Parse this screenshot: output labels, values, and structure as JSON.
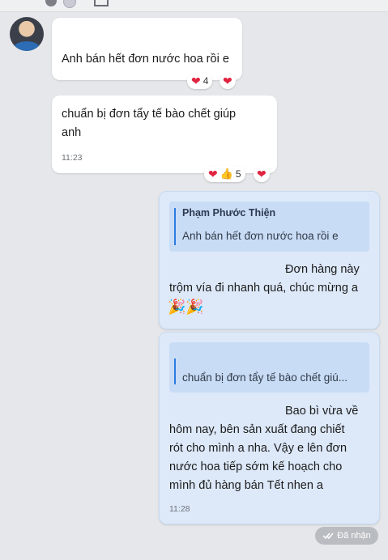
{
  "messages": [
    {
      "text": "Anh bán hết đơn nước hoa rồi e",
      "reactions": {
        "count": "4"
      }
    },
    {
      "text_lines": [
        "chuẩn bị đơn tẩy tế bào chết giúp",
        "anh"
      ],
      "time": "11:23",
      "reactions": {
        "count": "5"
      }
    },
    {
      "quote_name": "Phạm Phước Thiện",
      "quote_text": "Anh bán hết đơn nước hoa rồi e",
      "text_lines": [
        "Đơn hàng này",
        "trộm vía đi nhanh quá, chúc mừng a",
        "🎉🎉"
      ]
    },
    {
      "quote_text": "chuẩn bị đơn tẩy tế bào chết giú...",
      "text_lines": [
        "Bao bì vừa về",
        "hôm nay, bên sản xuất đang chiết",
        "rót cho mình a nha. Vậy e lên đơn",
        "nước hoa tiếp sớm kế hoạch cho",
        "mình đủ hàng bán Tết nhen a"
      ],
      "time": "11:28"
    }
  ],
  "status": {
    "label": "Đã nhận",
    "icon": "double-check-icon"
  },
  "icons": {
    "heart": "❤",
    "thumb": "👍",
    "party": "🎉"
  }
}
